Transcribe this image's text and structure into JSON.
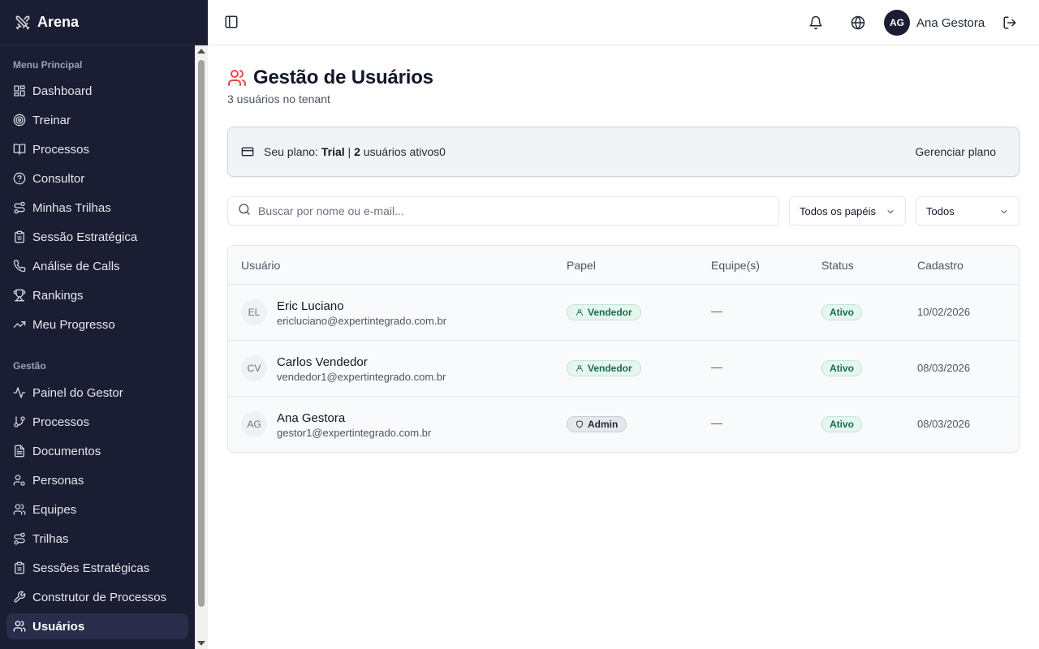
{
  "app": {
    "name": "Arena"
  },
  "sidebar": {
    "main_title": "Menu Principal",
    "main_items": [
      {
        "label": "Dashboard",
        "icon": "layout-grid-icon"
      },
      {
        "label": "Treinar",
        "icon": "target-icon"
      },
      {
        "label": "Processos",
        "icon": "book-open-icon"
      },
      {
        "label": "Consultor",
        "icon": "help-circle-icon"
      },
      {
        "label": "Minhas Trilhas",
        "icon": "route-icon"
      },
      {
        "label": "Sessão Estratégica",
        "icon": "clipboard-icon"
      },
      {
        "label": "Análise de Calls",
        "icon": "phone-icon"
      },
      {
        "label": "Rankings",
        "icon": "trophy-icon"
      },
      {
        "label": "Meu Progresso",
        "icon": "trending-up-icon"
      }
    ],
    "mgmt_title": "Gestão",
    "mgmt_items": [
      {
        "label": "Painel do Gestor",
        "icon": "activity-icon"
      },
      {
        "label": "Processos",
        "icon": "git-branch-icon"
      },
      {
        "label": "Documentos",
        "icon": "file-text-icon"
      },
      {
        "label": "Personas",
        "icon": "user-cog-icon"
      },
      {
        "label": "Equipes",
        "icon": "users-icon"
      },
      {
        "label": "Trilhas",
        "icon": "route-icon"
      },
      {
        "label": "Sessões Estratégicas",
        "icon": "clipboard-icon"
      },
      {
        "label": "Construtor de Processos",
        "icon": "wrench-icon"
      },
      {
        "label": "Usuários",
        "icon": "users-icon",
        "active": true
      }
    ]
  },
  "header": {
    "user_initials": "AG",
    "user_name": "Ana Gestora"
  },
  "page": {
    "title": "Gestão de Usuários",
    "subtitle": "3 usuários no tenant"
  },
  "plan": {
    "prefix": "Seu plano: ",
    "plan_name": "Trial",
    "separator": " | ",
    "active_count": "2",
    "active_suffix": " usuários ativos0",
    "manage_label": "Gerenciar plano"
  },
  "filters": {
    "search_placeholder": "Buscar por nome ou e-mail...",
    "role_selected": "Todos os papéis",
    "status_selected": "Todos"
  },
  "table": {
    "headers": {
      "user": "Usuário",
      "role": "Papel",
      "team": "Equipe(s)",
      "status": "Status",
      "date": "Cadastro"
    },
    "rows": [
      {
        "initials": "EL",
        "name": "Eric Luciano",
        "email": "ericluciano@expertintegrado.com.br",
        "role": "Vendedor",
        "role_type": "seller",
        "team": "—",
        "status": "Ativo",
        "date": "10/02/2026"
      },
      {
        "initials": "CV",
        "name": "Carlos Vendedor",
        "email": "vendedor1@expertintegrado.com.br",
        "role": "Vendedor",
        "role_type": "seller",
        "team": "—",
        "status": "Ativo",
        "date": "08/03/2026"
      },
      {
        "initials": "AG",
        "name": "Ana Gestora",
        "email": "gestor1@expertintegrado.com.br",
        "role": "Admin",
        "role_type": "admin",
        "team": "—",
        "status": "Ativo",
        "date": "08/03/2026"
      }
    ]
  },
  "colors": {
    "sidebar_bg": "#1b1d33",
    "accent_red": "#ef4444",
    "success_green": "#166a50"
  }
}
